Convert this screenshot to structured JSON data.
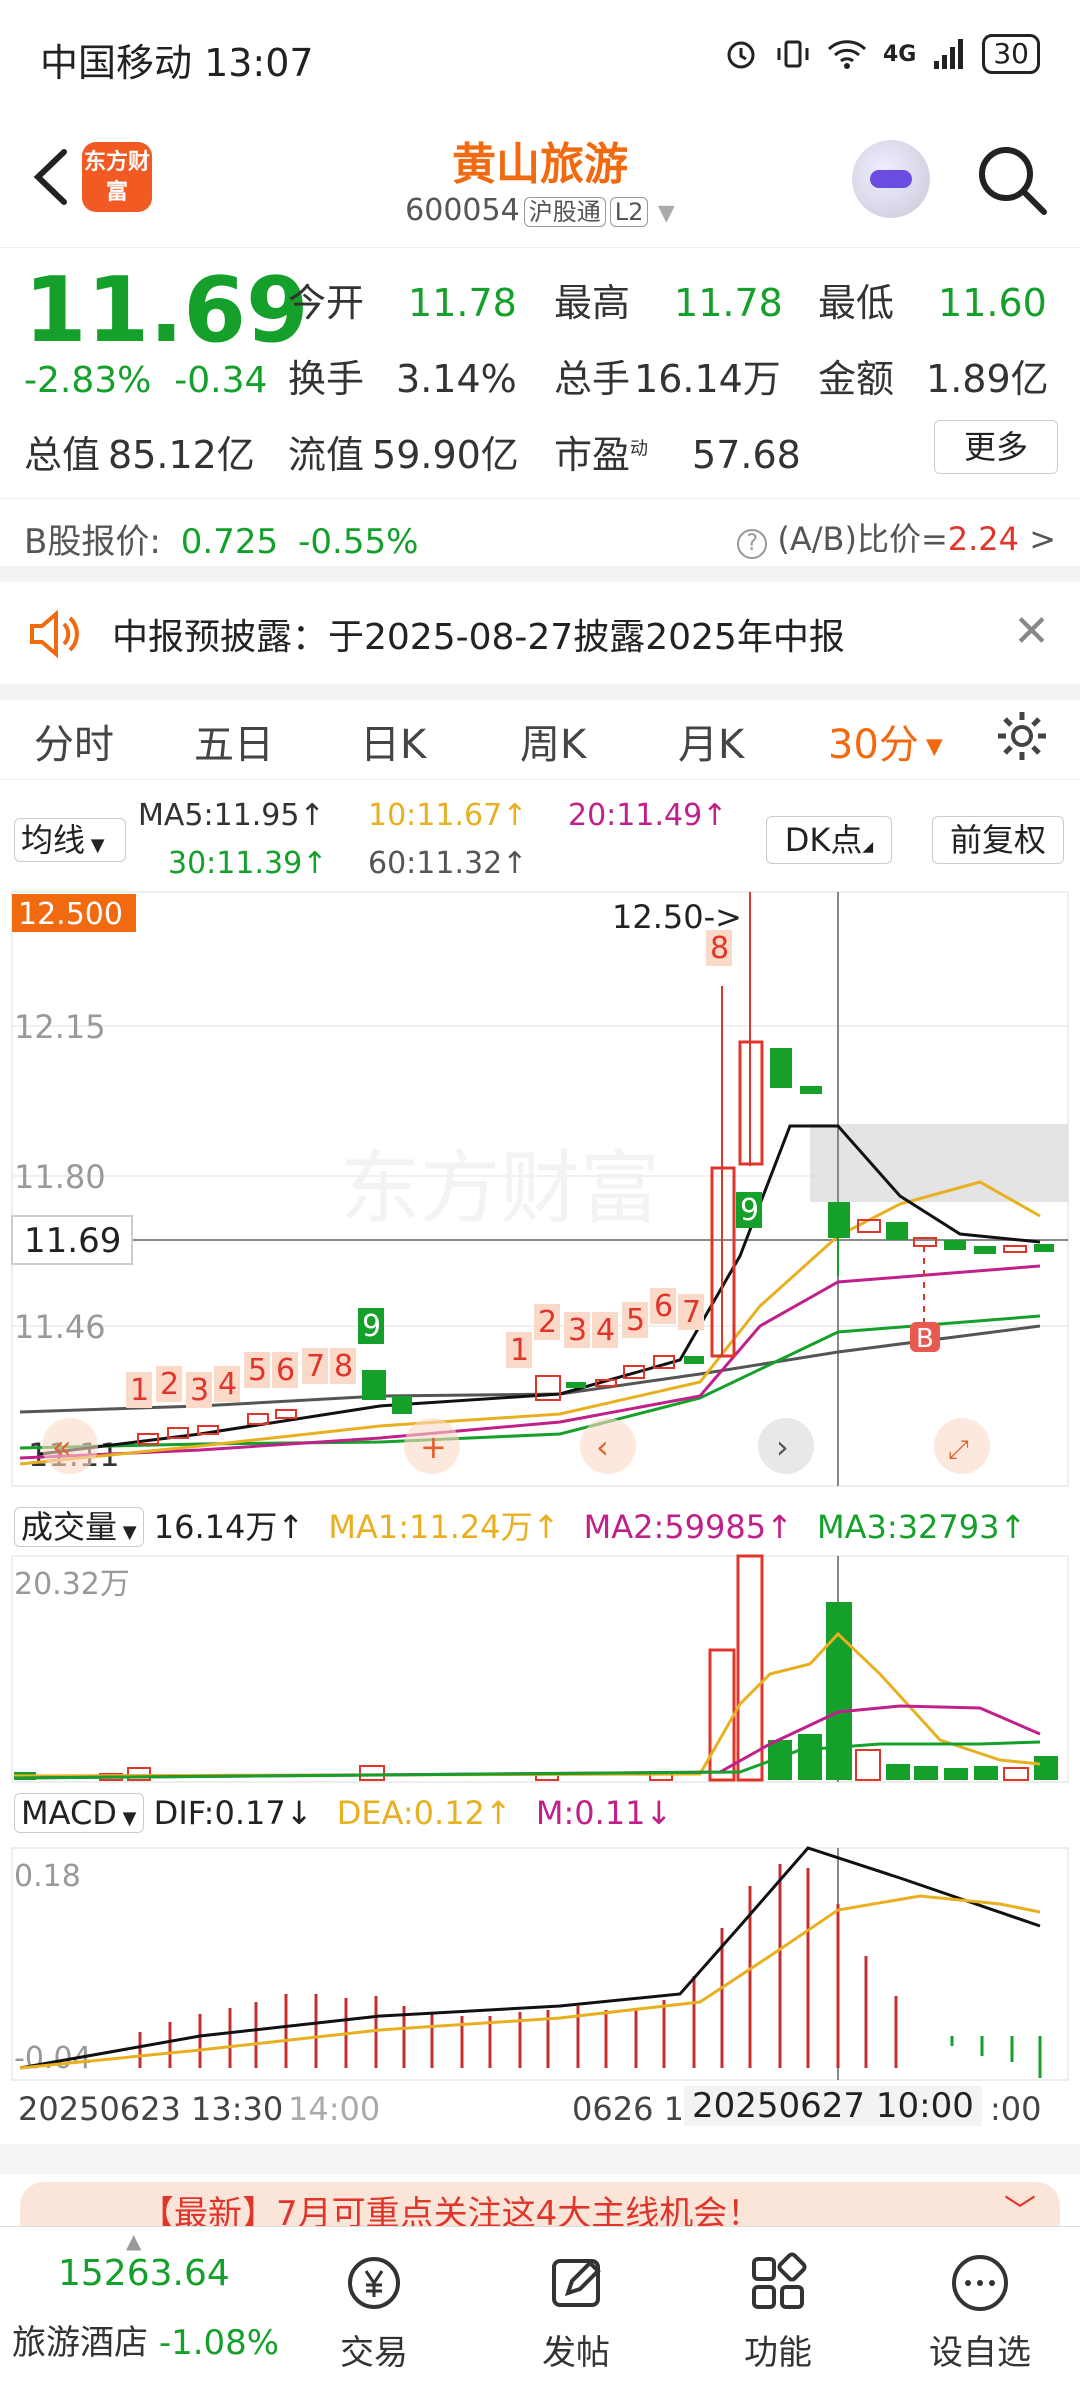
{
  "status": {
    "carrier": "中国移动 13:07",
    "battery": "30",
    "network": "4G"
  },
  "header": {
    "title": "黄山旅游",
    "code": "600054",
    "tag1": "沪股通",
    "tag2": "L2",
    "logo": "东方财富"
  },
  "quote": {
    "price": "11.69",
    "change_pct": "-2.83%",
    "change": "-0.34",
    "open_label": "今开",
    "open": "11.78",
    "high_label": "最高",
    "high": "11.78",
    "low_label": "最低",
    "low": "11.60",
    "turnover_label": "换手",
    "turnover": "3.14%",
    "volume_label": "总手",
    "volume": "16.14万",
    "amount_label": "金额",
    "amount": "1.89亿",
    "mktcap_label": "总值",
    "mktcap": "85.12亿",
    "float_label": "流值",
    "float": "59.90亿",
    "pe_label": "市盈",
    "pe_sup": "动",
    "pe": "57.68",
    "more": "更多"
  },
  "bshare": {
    "label": "B股报价:",
    "price": "0.725",
    "pct": "-0.55%",
    "ratio_label": "(A/B)比价=",
    "ratio": "2.24",
    "arrow": ">"
  },
  "notice": {
    "text": "中报预披露：于2025-08-27披露2025年中报"
  },
  "tabs": [
    "分时",
    "五日",
    "日K",
    "周K",
    "月K",
    "30分"
  ],
  "ma": {
    "btn": "均线",
    "ma5": "MA5:11.95↑",
    "ma10": "10:11.67↑",
    "ma20": "20:11.49↑",
    "ma30": "30:11.39↑",
    "ma60": "60:11.32↑",
    "dk": "DK点",
    "fq": "前复权"
  },
  "chart": {
    "yaxis": [
      "12.15",
      "11.80",
      "11.46",
      "11.11"
    ],
    "top_label": "12.500",
    "cursor_price": "11.69",
    "high_marker": "12.50->",
    "seq_red": [
      "1",
      "2",
      "3",
      "4",
      "5",
      "6",
      "7",
      "8",
      "1",
      "2",
      "3",
      "4",
      "5",
      "6",
      "7",
      "8"
    ],
    "seq_green": [
      "9",
      "9"
    ],
    "b_marker": "B",
    "watermark": "东方财富"
  },
  "volume": {
    "btn": "成交量",
    "val": "16.14万↑",
    "ma1": "MA1:11.24万↑",
    "ma2": "MA2:59985↑",
    "ma3": "MA3:32793↑",
    "ymax": "20.32万"
  },
  "macd": {
    "btn": "MACD",
    "dif": "DIF:0.17↓",
    "dea": "DEA:0.12↑",
    "m": "M:0.11↓",
    "ytop": "0.18",
    "ybot": "-0.04"
  },
  "xaxis": {
    "left": "20250623 13:30",
    "mid1": "14:00",
    "mid2": "0626 1",
    "cursor": "20250627 10:00",
    "right": ":00"
  },
  "banner": {
    "text": "【最新】7月可重点关注这4大主线机会！"
  },
  "bottom_nav": {
    "index_val": "15263.64",
    "index_name": "旅游酒店",
    "index_pct": "-1.08%",
    "items": [
      "交易",
      "发帖",
      "功能",
      "设自选"
    ]
  }
}
